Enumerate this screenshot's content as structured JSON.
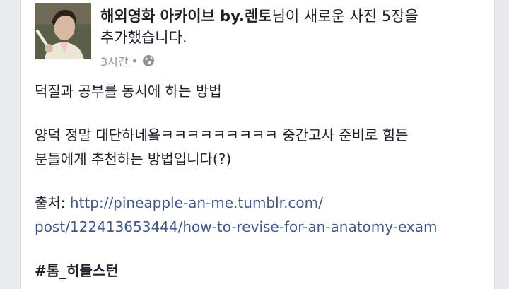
{
  "post": {
    "author": "해외영화 아카이브 by.렌토",
    "action_line1": "님이 새로운 사진 5장을",
    "action_line2": "추가했습니다.",
    "timestamp": "3시간",
    "separator": "•",
    "privacy_icon": "globe-icon",
    "title": "덕질과 공부를 동시에 하는 방법",
    "text_line1": "양덕 정말 대단하네욬ㅋㅋㅋㅋㅋㅋㅋㅋㅋ 중간고사 준비로 힘든",
    "text_line2": "분들에게 추천하는 방법입니다(?)",
    "source_label": "출처: ",
    "source_link_line1": "http://pineapple-an-me.tumblr.com/",
    "source_link_line2": "post/122413653444/how-to-revise-for-an-anatomy-exam",
    "hashtag": "#톰_히들스턴"
  },
  "colors": {
    "link": "#3b5998",
    "text": "#1d2129",
    "meta": "#90949c",
    "background": "#e9eaee"
  }
}
